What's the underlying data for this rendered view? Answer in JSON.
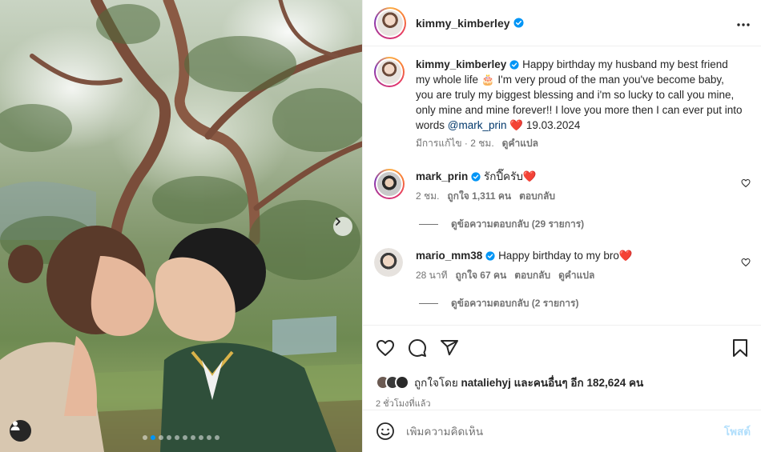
{
  "post": {
    "author": "kimmy_kimberley",
    "more_icon": "more-horizontal-icon",
    "caption": {
      "author": "kimmy_kimberley",
      "text_1": "Happy birthday my husband my best friend my whole life",
      "cake_emoji": "🎂",
      "text_2": "I'm very proud of the man you've become baby, you are truly my biggest blessing and i'm so lucky to call you mine, only mine and mine forever!! I love you more then I can ever put into words",
      "mention": "@mark_prin",
      "heart": "❤️",
      "date": "19.03.2024",
      "meta_edited": "มีการแก้ไข · 2 ชม.",
      "meta_translate": "ดูคำแปล"
    },
    "comments": [
      {
        "author": "mark_prin",
        "text": "รักปี๊ครับ",
        "heart": "❤️",
        "time": "2 ชม.",
        "likes": "ถูกใจ 1,311 คน",
        "reply": "ตอบกลับ",
        "translate": "",
        "view_replies": "ดูข้อความตอบกลับ (29 รายการ)"
      },
      {
        "author": "mario_mm38",
        "text": "Happy birthday to my bro",
        "heart": "❤️",
        "time": "28 นาที",
        "likes": "ถูกใจ 67 คน",
        "reply": "ตอบกลับ",
        "translate": "ดูคำแปล",
        "view_replies": "ดูข้อความตอบกลับ (2 รายการ)"
      }
    ],
    "liked_by_prefix": "ถูกใจโดย",
    "liked_by_user": "nataliehyj",
    "liked_by_suffix": "และคนอื่นๆ อีก 182,624 คน",
    "posted_ago": "2 ชั่วโมงที่แล้ว",
    "comment_placeholder": "เพิ่มความคิดเห็น",
    "post_button": "โพสต์",
    "carousel_slides": 10,
    "carousel_active": 1
  },
  "colors": {
    "verified": "#0095f6",
    "mention": "#00376b",
    "muted": "#737373",
    "post_disabled": "#b2dffc",
    "heart": "#e0245e"
  }
}
